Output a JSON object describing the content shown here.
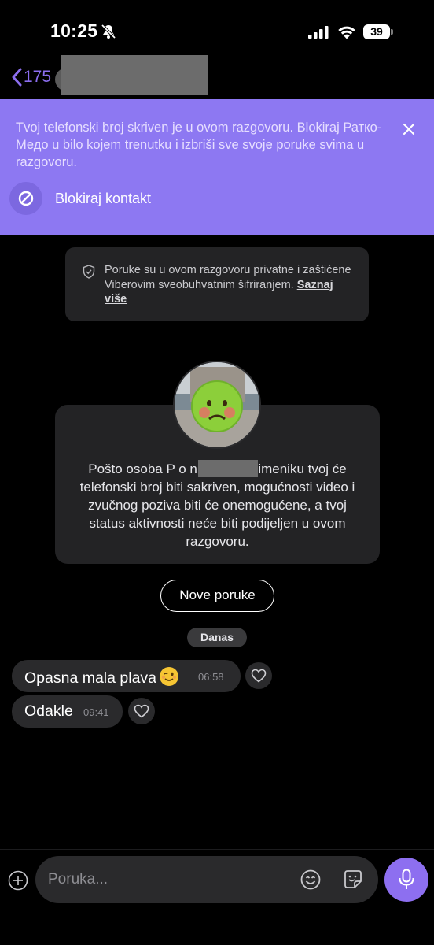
{
  "status_bar": {
    "time": "10:25",
    "battery": "39"
  },
  "header": {
    "back_count": "175"
  },
  "banner": {
    "text": "Tvoj telefonski broj skriven je u ovom razgovoru. Blokiraj Ратко-Медо u bilo kojem trenutku i izbriši sve svoje poruke svima u razgovoru.",
    "block_label": "Blokiraj kontakt",
    "background": "#8d78f2"
  },
  "encryption": {
    "text": "Poruke su u ovom razgovoru privatne i zaštićene Viberovim sveobuhvatnim šifriranjem.",
    "link": "Saznaj više"
  },
  "info_card": {
    "text": "Pošto osoba P              o nije u tvom imeniku tvoj će telefonski broj biti sakriven, mogućnosti video i zvučnog poziva biti će onemogućene, a tvoj status aktivnosti neće biti podijeljen u ovom razgovoru."
  },
  "new_messages_label": "Nove poruke",
  "date_label": "Danas",
  "messages": [
    {
      "text": "Opasna mala plava",
      "emoji": "winking-face",
      "time": "06:58"
    },
    {
      "text": "Odakle",
      "time": "09:41"
    }
  ],
  "composer": {
    "placeholder": "Poruka..."
  },
  "colors": {
    "accent": "#8d6ff0",
    "bubble": "#2a2a2c",
    "card": "#232325"
  }
}
